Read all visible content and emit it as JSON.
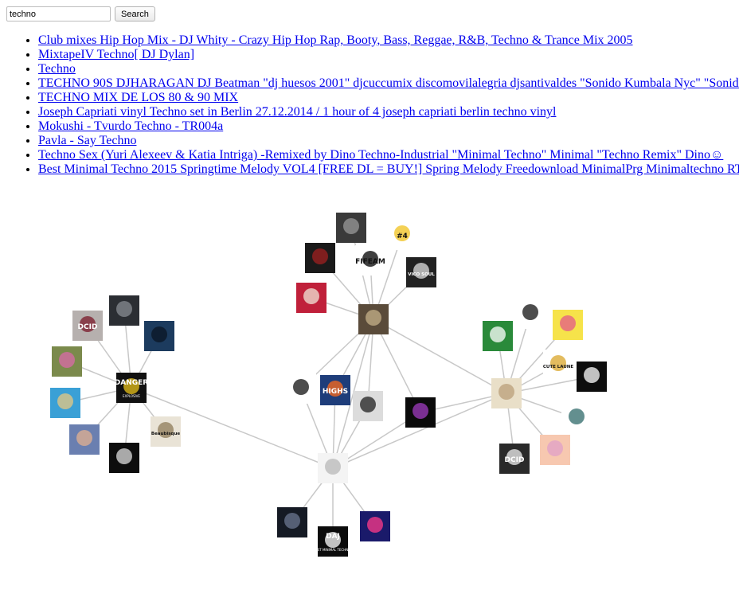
{
  "search": {
    "value": "techno",
    "button_label": "Search"
  },
  "results": [
    "Club mixes Hip Hop Mix - DJ Whity - Crazy Hip Hop Rap, Booty, Bass, Reggae, R&B, Techno & Trance Mix 2005",
    "MixtapeIV Techno[ DJ Dylan]",
    "Techno",
    "TECHNO 90S DJHARAGAN DJ  Beatman \"dj huesos 2001\" djcuccumix discomovilalegria djsantivaldes \"Sonido Kumbala Nyc\" \"Sonido",
    "TECHNO MIX DE LOS 80 & 90 MIX",
    "Joseph Capriati vinyl Techno set in Berlin 27.12.2014 / 1 hour of 4 joseph capriati berlin techno vinyl",
    "Mokushi - Tvurdo Techno - TR004a",
    "Pavla - Say Techno",
    "Techno Sex (Yuri Alexeev & Katia Intriga) -Remixed by Dino Techno-Industrial \"Minimal Techno\" Minimal \"Techno Remix\" Dino☺",
    "Best Minimal Techno 2015 Springtime Melody VOL4 [FREE DL = BUY!] Spring Melody Freedownload MinimalPrg Minimaltechno RT"
  ],
  "graph": {
    "edge_color": "#c8c8c8",
    "nodes": {
      "danger": {
        "label": "DANGER",
        "sub": "EXPLOSIVE",
        "colors": [
          "#111111",
          "#e8c21a"
        ]
      },
      "dcid_left": {
        "label": "DCID",
        "colors": [
          "#b6b0ae",
          "#7a1a2a"
        ]
      },
      "dark_vinyl": {
        "colors": [
          "#2b2e33",
          "#888c93"
        ]
      },
      "night_sky": {
        "colors": [
          "#1c3b5e",
          "#0a1524"
        ]
      },
      "green_eye": {
        "colors": [
          "#7b8a4c",
          "#d96aa8"
        ]
      },
      "blonde": {
        "colors": [
          "#3aa0d6",
          "#e8c880"
        ]
      },
      "portrait": {
        "colors": [
          "#6a7fb0",
          "#e3b090"
        ]
      },
      "boutique": {
        "label": "Beaubisque",
        "colors": [
          "#e9e3d6",
          "#8d7b58"
        ]
      },
      "black_logo": {
        "colors": [
          "#0d0d0d",
          "#dddddd"
        ]
      },
      "hub_top": {
        "colors": [
          "#5a4b3a",
          "#c5b08a"
        ]
      },
      "storm": {
        "colors": [
          "#3a3a3a",
          "#9a9a9a"
        ]
      },
      "number4": {
        "label": "#4",
        "colors": [
          "#ffffff",
          "#f0c21c"
        ]
      },
      "red_grid": {
        "colors": [
          "#1a1a1a",
          "#a02020"
        ]
      },
      "vinyl_half": {
        "label": "FIFEAM",
        "colors": [
          "#ffffff",
          "#000000"
        ]
      },
      "vicoleoul": {
        "label": "VICO SOUL",
        "colors": [
          "#222222",
          "#e0e0e0"
        ]
      },
      "face_mask": {
        "colors": [
          "#c0203a",
          "#f2e6d8"
        ]
      },
      "silhouettes": {
        "colors": [
          "#ffffff",
          "#111111"
        ]
      },
      "highs": {
        "label": "HIGHS",
        "colors": [
          "#1e3d7a",
          "#ff6a1a"
        ]
      },
      "bw_hands": {
        "colors": [
          "#dcdcdc",
          "#202020"
        ]
      },
      "stripes": {
        "colors": [
          "#0a0a0a",
          "#a03cc0"
        ]
      },
      "hub_center": {
        "colors": [
          "#f4f4f4",
          "#b8b8b8"
        ]
      },
      "dark_title": {
        "colors": [
          "#151a24",
          "#6b7790"
        ]
      },
      "daj": {
        "label": "DAJ",
        "sub": "AUGUST MINIMAL TECHNO MIX",
        "colors": [
          "#0b0b0b",
          "#ffffff"
        ]
      },
      "blue_fx": {
        "colors": [
          "#1a1a6a",
          "#ff3a8a"
        ]
      },
      "hub_right": {
        "colors": [
          "#e9dfc8",
          "#b99f7a"
        ]
      },
      "bw_ink": {
        "colors": [
          "#ffffff",
          "#111111"
        ]
      },
      "yellow_card": {
        "colors": [
          "#f6e34a",
          "#e35a8a"
        ]
      },
      "green_alien": {
        "colors": [
          "#2a8a3a",
          "#ffffff"
        ]
      },
      "gold_coins": {
        "label": "CUTE LAUNE",
        "colors": [
          "#ffffff",
          "#d9a62a"
        ]
      },
      "round_badge": {
        "colors": [
          "#0d0d0d",
          "#ffffff"
        ]
      },
      "robot_face": {
        "colors": [
          "#ffffff",
          "#2f6a6a"
        ]
      },
      "dcid_right": {
        "label": "DCID",
        "colors": [
          "#2a2a2a",
          "#f0f0f0"
        ]
      },
      "pastel_card": {
        "colors": [
          "#f7c8b0",
          "#e0a0c8"
        ]
      }
    }
  }
}
